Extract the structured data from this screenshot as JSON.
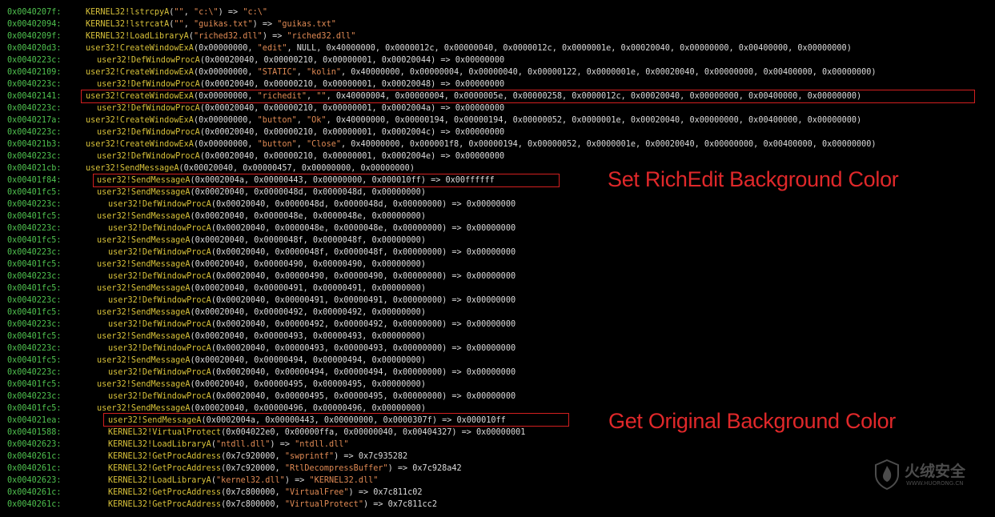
{
  "rows": [
    {
      "addr": "0x0040207f:",
      "indent": 0,
      "fn": "KERNEL32!lstrcpyA",
      "a": "(\"\", \"c:\\\") => \"c:\\\""
    },
    {
      "addr": "0x00402094:",
      "indent": 0,
      "fn": "KERNEL32!lstrcatA",
      "a": "(\"\", \"guikas.txt\") => \"guikas.txt\""
    },
    {
      "addr": "0x0040209f:",
      "indent": 0,
      "fn": "KERNEL32!LoadLibraryA",
      "a": "(\"riched32.dll\") => \"riched32.dll\""
    },
    {
      "addr": "0x004020d3:",
      "indent": 0,
      "fn": "user32!CreateWindowExA",
      "a": "(0x00000000, \"edit\", NULL, 0x40000000, 0x0000012c, 0x00000040, 0x0000012c, 0x0000001e, 0x00020040, 0x00000000, 0x00400000, 0x00000000)"
    },
    {
      "addr": "0x0040223c:",
      "indent": 1,
      "fn": "user32!DefWindowProcA",
      "a": "(0x00020040, 0x00000210, 0x00000001, 0x00020044) => 0x00000000"
    },
    {
      "addr": "0x00402109:",
      "indent": 0,
      "fn": "user32!CreateWindowExA",
      "a": "(0x00000000, \"STATIC\", \"kolin\", 0x40000000, 0x00000004, 0x00000040, 0x00000122, 0x0000001e, 0x00020040, 0x00000000, 0x00400000, 0x00000000)"
    },
    {
      "addr": "0x0040223c:",
      "indent": 1,
      "fn": "user32!DefWindowProcA",
      "a": "(0x00020040, 0x00000210, 0x00000001, 0x00020048) => 0x00000000"
    },
    {
      "addr": "0x00402141:",
      "indent": 0,
      "fn": "user32!CreateWindowExA",
      "a": "(0x00000000, \"richedit\", \"\", 0x40000004, 0x00000004, 0x0000005e, 0x00000258, 0x0000012c, 0x00020040, 0x00000000, 0x00400000, 0x00000000)"
    },
    {
      "addr": "0x0040223c:",
      "indent": 1,
      "fn": "user32!DefWindowProcA",
      "a": "(0x00020040, 0x00000210, 0x00000001, 0x0002004a) => 0x00000000"
    },
    {
      "addr": "0x0040217a:",
      "indent": 0,
      "fn": "user32!CreateWindowExA",
      "a": "(0x00000000, \"button\", \"Ok\", 0x40000000, 0x00000194, 0x00000194, 0x00000052, 0x0000001e, 0x00020040, 0x00000000, 0x00400000, 0x00000000)"
    },
    {
      "addr": "0x0040223c:",
      "indent": 1,
      "fn": "user32!DefWindowProcA",
      "a": "(0x00020040, 0x00000210, 0x00000001, 0x0002004c) => 0x00000000"
    },
    {
      "addr": "0x004021b3:",
      "indent": 0,
      "fn": "user32!CreateWindowExA",
      "a": "(0x00000000, \"button\", \"Close\", 0x40000000, 0x000001f8, 0x00000194, 0x00000052, 0x0000001e, 0x00020040, 0x00000000, 0x00400000, 0x00000000)"
    },
    {
      "addr": "0x0040223c:",
      "indent": 1,
      "fn": "user32!DefWindowProcA",
      "a": "(0x00020040, 0x00000210, 0x00000001, 0x0002004e) => 0x00000000"
    },
    {
      "addr": "0x004021cb:",
      "indent": 0,
      "fn": "user32!SendMessageA",
      "a": "(0x00020040, 0x00000457, 0x00000000, 0x00000000)"
    },
    {
      "addr": "0x00401f84:",
      "indent": 1,
      "fn": "user32!SendMessageA",
      "a": "(0x0002004a, 0x00000443, 0x00000000, 0x000010ff) => 0x00ffffff"
    },
    {
      "addr": "0x00401fc5:",
      "indent": 1,
      "fn": "user32!SendMessageA",
      "a": "(0x00020040, 0x0000048d, 0x0000048d, 0x00000000)"
    },
    {
      "addr": "0x0040223c:",
      "indent": 2,
      "fn": "user32!DefWindowProcA",
      "a": "(0x00020040, 0x0000048d, 0x0000048d, 0x00000000) => 0x00000000"
    },
    {
      "addr": "0x00401fc5:",
      "indent": 1,
      "fn": "user32!SendMessageA",
      "a": "(0x00020040, 0x0000048e, 0x0000048e, 0x00000000)"
    },
    {
      "addr": "0x0040223c:",
      "indent": 2,
      "fn": "user32!DefWindowProcA",
      "a": "(0x00020040, 0x0000048e, 0x0000048e, 0x00000000) => 0x00000000"
    },
    {
      "addr": "0x00401fc5:",
      "indent": 1,
      "fn": "user32!SendMessageA",
      "a": "(0x00020040, 0x0000048f, 0x0000048f, 0x00000000)"
    },
    {
      "addr": "0x0040223c:",
      "indent": 2,
      "fn": "user32!DefWindowProcA",
      "a": "(0x00020040, 0x0000048f, 0x0000048f, 0x00000000) => 0x00000000"
    },
    {
      "addr": "0x00401fc5:",
      "indent": 1,
      "fn": "user32!SendMessageA",
      "a": "(0x00020040, 0x00000490, 0x00000490, 0x00000000)"
    },
    {
      "addr": "0x0040223c:",
      "indent": 2,
      "fn": "user32!DefWindowProcA",
      "a": "(0x00020040, 0x00000490, 0x00000490, 0x00000000) => 0x00000000"
    },
    {
      "addr": "0x00401fc5:",
      "indent": 1,
      "fn": "user32!SendMessageA",
      "a": "(0x00020040, 0x00000491, 0x00000491, 0x00000000)"
    },
    {
      "addr": "0x0040223c:",
      "indent": 2,
      "fn": "user32!DefWindowProcA",
      "a": "(0x00020040, 0x00000491, 0x00000491, 0x00000000) => 0x00000000"
    },
    {
      "addr": "0x00401fc5:",
      "indent": 1,
      "fn": "user32!SendMessageA",
      "a": "(0x00020040, 0x00000492, 0x00000492, 0x00000000)"
    },
    {
      "addr": "0x0040223c:",
      "indent": 2,
      "fn": "user32!DefWindowProcA",
      "a": "(0x00020040, 0x00000492, 0x00000492, 0x00000000) => 0x00000000"
    },
    {
      "addr": "0x00401fc5:",
      "indent": 1,
      "fn": "user32!SendMessageA",
      "a": "(0x00020040, 0x00000493, 0x00000493, 0x00000000)"
    },
    {
      "addr": "0x0040223c:",
      "indent": 2,
      "fn": "user32!DefWindowProcA",
      "a": "(0x00020040, 0x00000493, 0x00000493, 0x00000000) => 0x00000000"
    },
    {
      "addr": "0x00401fc5:",
      "indent": 1,
      "fn": "user32!SendMessageA",
      "a": "(0x00020040, 0x00000494, 0x00000494, 0x00000000)"
    },
    {
      "addr": "0x0040223c:",
      "indent": 2,
      "fn": "user32!DefWindowProcA",
      "a": "(0x00020040, 0x00000494, 0x00000494, 0x00000000) => 0x00000000"
    },
    {
      "addr": "0x00401fc5:",
      "indent": 1,
      "fn": "user32!SendMessageA",
      "a": "(0x00020040, 0x00000495, 0x00000495, 0x00000000)"
    },
    {
      "addr": "0x0040223c:",
      "indent": 2,
      "fn": "user32!DefWindowProcA",
      "a": "(0x00020040, 0x00000495, 0x00000495, 0x00000000) => 0x00000000"
    },
    {
      "addr": "0x00401fc5:",
      "indent": 1,
      "fn": "user32!SendMessageA",
      "a": "(0x00020040, 0x00000496, 0x00000496, 0x00000000)"
    },
    {
      "addr": "0x004021ea:",
      "indent": 2,
      "fn": "user32!SendMessageA",
      "a": "(0x0002004a, 0x00000443, 0x00000000, 0x0000307f) => 0x000010ff"
    },
    {
      "addr": "0x00401588:",
      "indent": 2,
      "fn": "KERNEL32!VirtualProtect",
      "a": "(0x004022e0, 0x00000ffa, 0x00000040, 0x00404327) => 0x00000001"
    },
    {
      "addr": "0x00402623:",
      "indent": 2,
      "fn": "KERNEL32!LoadLibraryA",
      "a": "(\"ntdll.dll\") => \"ntdll.dll\""
    },
    {
      "addr": "0x0040261c:",
      "indent": 2,
      "fn": "KERNEL32!GetProcAddress",
      "a": "(0x7c920000, \"swprintf\") => 0x7c935282"
    },
    {
      "addr": "0x0040261c:",
      "indent": 2,
      "fn": "KERNEL32!GetProcAddress",
      "a": "(0x7c920000, \"RtlDecompressBuffer\") => 0x7c928a42"
    },
    {
      "addr": "0x00402623:",
      "indent": 2,
      "fn": "KERNEL32!LoadLibraryA",
      "a": "(\"kernel32.dll\") => \"KERNEL32.dll\""
    },
    {
      "addr": "0x0040261c:",
      "indent": 2,
      "fn": "KERNEL32!GetProcAddress",
      "a": "(0x7c800000, \"VirtualFree\") => 0x7c811c02"
    },
    {
      "addr": "0x0040261c:",
      "indent": 2,
      "fn": "KERNEL32!GetProcAddress",
      "a": "(0x7c800000, \"VirtualProtect\") => 0x7c811cc2"
    }
  ],
  "annotations": {
    "set_bg": "Set RichEdit Background Color",
    "get_bg": "Get Original Background Color"
  },
  "watermark": {
    "text": "火绒安全",
    "url": "WWW.HUORONG.CN"
  },
  "colors": {
    "background": "#000000",
    "address": "#4fc24f",
    "function": "#d8c23a",
    "args": "#dcdcdc",
    "string": "#e08a54",
    "highlight": "#d21f1f"
  }
}
